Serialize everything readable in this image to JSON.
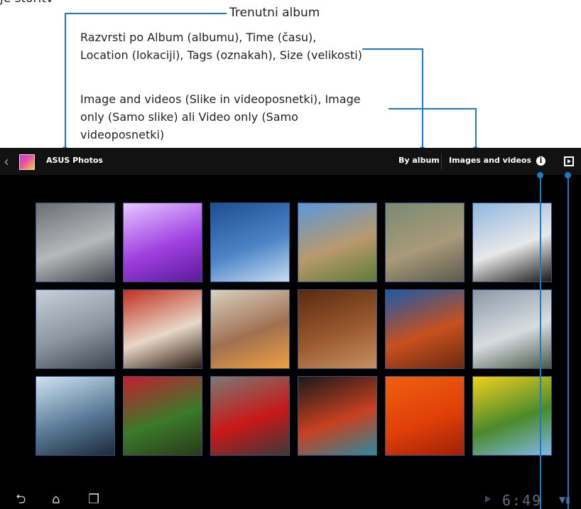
{
  "annotations": {
    "cut_text": "je storitv",
    "current_album": "Trenutni album",
    "sort_by": "Razvrsti po Album (albumu), Time (času), Location (lokaciji), Tags (oznakah), Size (velikosti)",
    "media_filter": "Image and videos (Slike in videoposnetki), Image only (Samo slike) ali Video only (Samo videoposnetki)"
  },
  "actionbar": {
    "app_title": "ASUS Photos",
    "sort_label": "By album",
    "media_label": "Images and videos",
    "info_glyph": "i"
  },
  "navbar": {
    "back_glyph": "⮌",
    "home_glyph": "⌂",
    "recent_glyph": "❐",
    "clock": "6:49",
    "status_glyph": "▼▮"
  },
  "thumbnails": [
    {
      "subject": "skyscraper-sculpture",
      "colors": [
        "#6b6e73",
        "#b7b8bc",
        "#44454a"
      ]
    },
    {
      "subject": "purple-flower",
      "colors": [
        "#e6c8ff",
        "#a040e0",
        "#5a1a9a"
      ]
    },
    {
      "subject": "airplane-wing",
      "colors": [
        "#1d4e93",
        "#4c84c8",
        "#c8ddf0"
      ]
    },
    {
      "subject": "gothic-cathedral",
      "colors": [
        "#5c97d9",
        "#b89a6c",
        "#5e7b3a"
      ]
    },
    {
      "subject": "street-statue",
      "colors": [
        "#7b8a72",
        "#a89a7a",
        "#5c5a4e"
      ]
    },
    {
      "subject": "penguins",
      "colors": [
        "#90b7e0",
        "#e8e8e8",
        "#1a1a1a"
      ]
    },
    {
      "subject": "cloud-gate",
      "colors": [
        "#c8d0d8",
        "#8c959f",
        "#3e4650"
      ]
    },
    {
      "subject": "geisha",
      "colors": [
        "#c03020",
        "#e8d8c8",
        "#2a1a10"
      ]
    },
    {
      "subject": "dining-table",
      "colors": [
        "#d8d0c0",
        "#a07050",
        "#f0a040"
      ]
    },
    {
      "subject": "chocolate-cake",
      "colors": [
        "#5a2a10",
        "#9a5a30",
        "#c89060"
      ]
    },
    {
      "subject": "desert-mesa",
      "colors": [
        "#1a5aa8",
        "#c8501e",
        "#6a2a10"
      ]
    },
    {
      "subject": "koala",
      "colors": [
        "#8a9aa8",
        "#d8dce0",
        "#4a5a4a"
      ]
    },
    {
      "subject": "glass-escalator",
      "colors": [
        "#cfe4f4",
        "#5a7a96",
        "#1a2a3a"
      ]
    },
    {
      "subject": "red-rose",
      "colors": [
        "#c02030",
        "#3a7a2a",
        "#2a3a1a"
      ]
    },
    {
      "subject": "red-postbox",
      "colors": [
        "#7a7a72",
        "#c81818",
        "#3a3a38"
      ]
    },
    {
      "subject": "stained-glass-window",
      "colors": [
        "#1a1a1a",
        "#c84020",
        "#2a8a9a"
      ]
    },
    {
      "subject": "orange-flower",
      "colors": [
        "#f06010",
        "#e04008",
        "#a02008"
      ]
    },
    {
      "subject": "yellow-tulips",
      "colors": [
        "#f0d020",
        "#4a8a2a",
        "#80b8e8"
      ]
    }
  ]
}
